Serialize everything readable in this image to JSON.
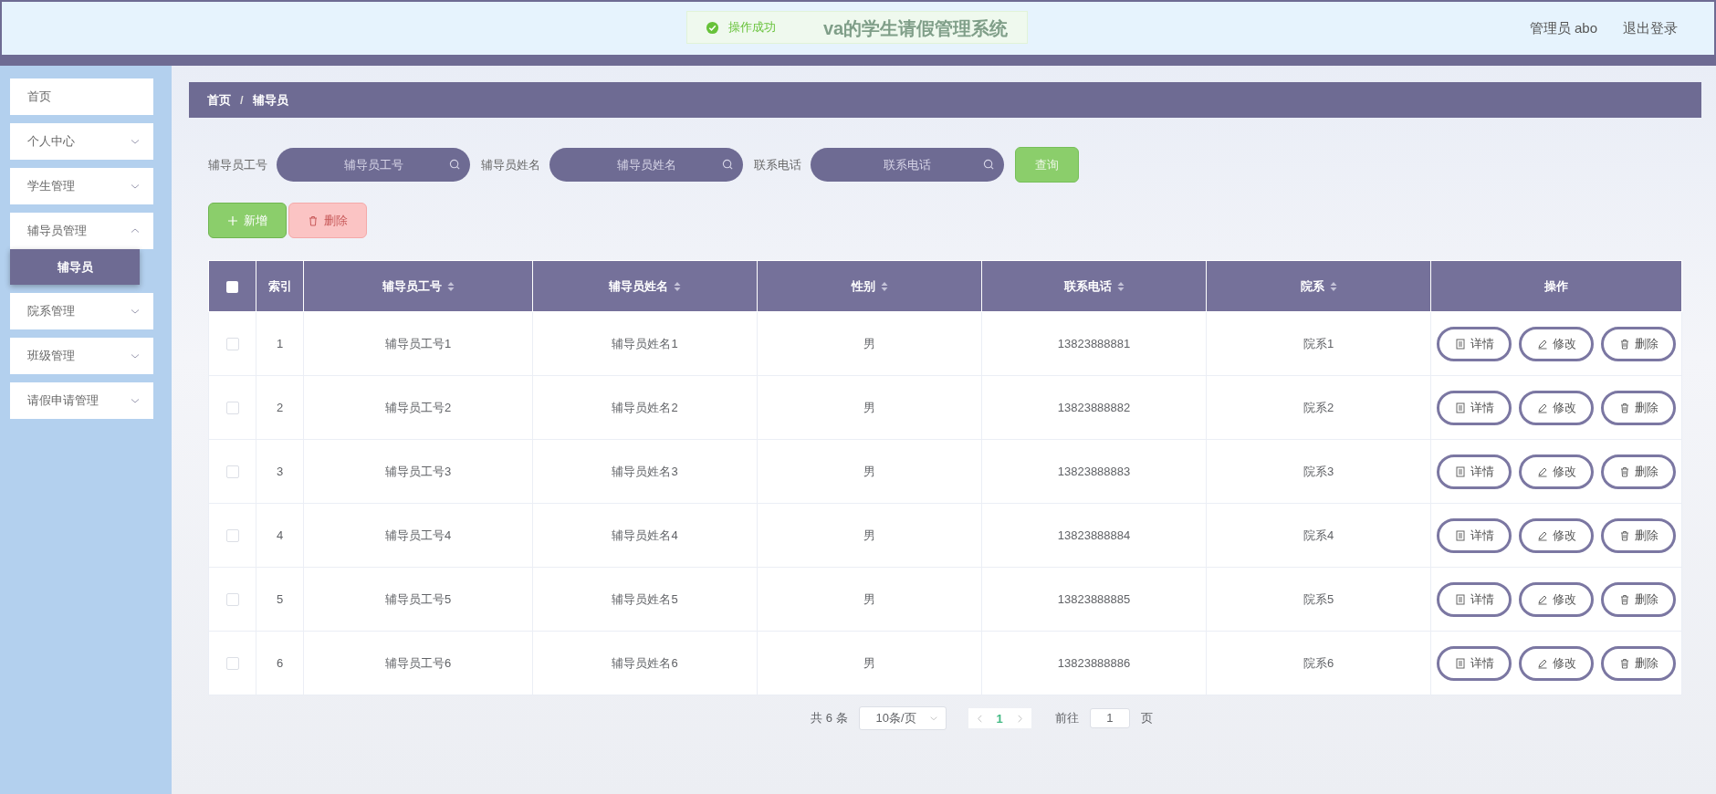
{
  "header": {
    "title": "va的学生请假管理系统",
    "toast": {
      "kind": "success",
      "message": "操作成功"
    },
    "user": "管理员 abo",
    "logout": "退出登录"
  },
  "sidebar": {
    "items": [
      {
        "label": "首页",
        "kind": "link",
        "selected": false
      },
      {
        "label": "个人中心",
        "kind": "menu",
        "expanded": false
      },
      {
        "label": "学生管理",
        "kind": "menu",
        "expanded": false
      },
      {
        "label": "辅导员管理",
        "kind": "menu",
        "expanded": true,
        "children": [
          {
            "label": "辅导员",
            "selected": true
          }
        ]
      },
      {
        "label": "院系管理",
        "kind": "menu",
        "expanded": false
      },
      {
        "label": "班级管理",
        "kind": "menu",
        "expanded": false
      },
      {
        "label": "请假申请管理",
        "kind": "menu",
        "expanded": false
      }
    ]
  },
  "breadcrumb": {
    "items": [
      "首页",
      "辅导员"
    ],
    "separator": "/"
  },
  "search": {
    "fields": [
      {
        "label": "辅导员工号",
        "placeholder": "辅导员工号"
      },
      {
        "label": "辅导员姓名",
        "placeholder": "辅导员姓名"
      },
      {
        "label": "联系电话",
        "placeholder": "联系电话"
      }
    ],
    "button": "查询"
  },
  "actions": [
    {
      "kind": "add",
      "label": "新增",
      "disabled": false
    },
    {
      "kind": "delete",
      "label": "删除",
      "disabled": true
    }
  ],
  "table": {
    "header_checkbox": {
      "checked": false
    },
    "columns": [
      {
        "label": "索引",
        "sortable": false
      },
      {
        "label": "辅导员工号",
        "sortable": true
      },
      {
        "label": "辅导员姓名",
        "sortable": true
      },
      {
        "label": "性别",
        "sortable": true
      },
      {
        "label": "联系电话",
        "sortable": true
      },
      {
        "label": "院系",
        "sortable": true
      },
      {
        "label": "操作",
        "sortable": false
      }
    ],
    "rows": [
      {
        "checked": false,
        "cells": [
          "1",
          "辅导员工号1",
          "辅导员姓名1",
          "男",
          "13823888881",
          "院系1"
        ],
        "actions": [
          {
            "kind": "detail",
            "label": "详情"
          },
          {
            "kind": "edit",
            "label": "修改"
          },
          {
            "kind": "delete",
            "label": "删除"
          }
        ]
      },
      {
        "checked": false,
        "cells": [
          "2",
          "辅导员工号2",
          "辅导员姓名2",
          "男",
          "13823888882",
          "院系2"
        ],
        "actions": [
          {
            "kind": "detail",
            "label": "详情"
          },
          {
            "kind": "edit",
            "label": "修改"
          },
          {
            "kind": "delete",
            "label": "删除"
          }
        ]
      },
      {
        "checked": false,
        "cells": [
          "3",
          "辅导员工号3",
          "辅导员姓名3",
          "男",
          "13823888883",
          "院系3"
        ],
        "actions": [
          {
            "kind": "detail",
            "label": "详情"
          },
          {
            "kind": "edit",
            "label": "修改"
          },
          {
            "kind": "delete",
            "label": "删除"
          }
        ]
      },
      {
        "checked": false,
        "cells": [
          "4",
          "辅导员工号4",
          "辅导员姓名4",
          "男",
          "13823888884",
          "院系4"
        ],
        "actions": [
          {
            "kind": "detail",
            "label": "详情"
          },
          {
            "kind": "edit",
            "label": "修改"
          },
          {
            "kind": "delete",
            "label": "删除"
          }
        ]
      },
      {
        "checked": false,
        "cells": [
          "5",
          "辅导员工号5",
          "辅导员姓名5",
          "男",
          "13823888885",
          "院系5"
        ],
        "actions": [
          {
            "kind": "detail",
            "label": "详情"
          },
          {
            "kind": "edit",
            "label": "修改"
          },
          {
            "kind": "delete",
            "label": "删除"
          }
        ]
      },
      {
        "checked": false,
        "cells": [
          "6",
          "辅导员工号6",
          "辅导员姓名6",
          "男",
          "13823888886",
          "院系6"
        ],
        "actions": [
          {
            "kind": "detail",
            "label": "详情"
          },
          {
            "kind": "edit",
            "label": "修改"
          },
          {
            "kind": "delete",
            "label": "删除"
          }
        ]
      }
    ]
  },
  "pagination": {
    "total": "共 6 条",
    "page_size": "10条/页",
    "pages": [
      {
        "label": "1",
        "selected": true
      }
    ],
    "goto_label": "前往",
    "goto_value": "1",
    "goto_unit": "页"
  }
}
